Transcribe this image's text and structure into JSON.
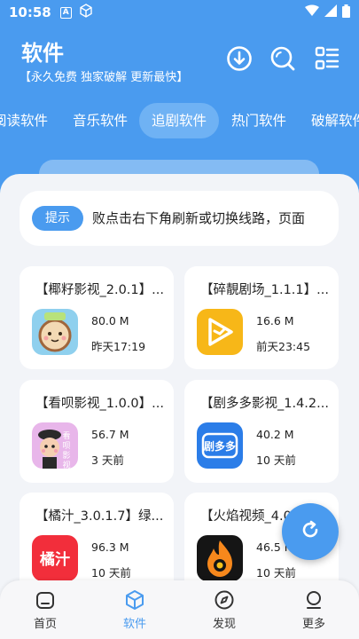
{
  "status_bar": {
    "time": "10:58",
    "a_badge": "A"
  },
  "header": {
    "title": "软件",
    "subtitle": "【永久免费 独家破解 更新最快】",
    "icons": [
      "download-icon",
      "search-icon",
      "list-icon"
    ]
  },
  "tabs": [
    {
      "label": "阅读软件",
      "active": false
    },
    {
      "label": "音乐软件",
      "active": false
    },
    {
      "label": "追剧软件",
      "active": true
    },
    {
      "label": "热门软件",
      "active": false
    },
    {
      "label": "破解软件",
      "active": false
    }
  ],
  "notice": {
    "button_label": "提示",
    "text": "败点击右下角刷新或切换线路，页面"
  },
  "apps": [
    {
      "title": "【椰籽影视_2.0.1】...",
      "size": "80.0 M",
      "time": "昨天17:19",
      "icon": "coconut-icon",
      "icon_color": "#8fd0ee"
    },
    {
      "title": "【碎靚剧场_1.1.1】...",
      "size": "16.6 M",
      "time": "前天23:45",
      "icon": "play-icon",
      "icon_color": "#f7b718"
    },
    {
      "title": "【看呗影视_1.0.0】...",
      "size": "56.7 M",
      "time": "3 天前",
      "icon": "cartoon-face-icon",
      "icon_color": "#e8b6ea",
      "icon_text": "看呗影视"
    },
    {
      "title": "【剧多多影视_1.4.2...",
      "size": "40.2 M",
      "time": "10 天前",
      "icon": "juduoduo-icon",
      "icon_color": "#2b7de8",
      "icon_text": "剧多多"
    },
    {
      "title": "【橘汁_3.0.1.7】绿...",
      "size": "96.3 M",
      "time": "10 天前",
      "icon": "juzhi-icon",
      "icon_color": "#f22e3b",
      "icon_text": "橘汁"
    },
    {
      "title": "【火焰视频_4.0...",
      "size": "46.5 M",
      "time": "10 天前",
      "icon": "flame-icon",
      "icon_color": "#151515"
    }
  ],
  "fab": {
    "icon": "refresh-icon"
  },
  "bottom_nav": [
    {
      "label": "首页",
      "icon": "home-icon",
      "active": false
    },
    {
      "label": "软件",
      "icon": "box-icon",
      "active": true
    },
    {
      "label": "发现",
      "icon": "compass-icon",
      "active": false
    },
    {
      "label": "更多",
      "icon": "more-icon",
      "active": false
    }
  ],
  "colors": {
    "accent": "#4a9bef",
    "tab_active_bg": "#6fb2f4",
    "background": "#f2f4f8"
  }
}
